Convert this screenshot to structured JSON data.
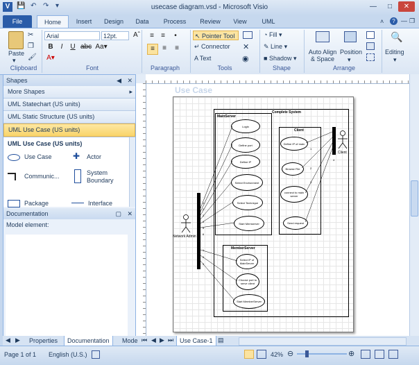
{
  "window": {
    "title": "usecase diagram.vsd - Microsoft Visio"
  },
  "tabs": [
    "File",
    "Home",
    "Insert",
    "Design",
    "Data",
    "Process",
    "Review",
    "View",
    "UML"
  ],
  "ribbon": {
    "font_name": "Arial",
    "font_size": "12pt.",
    "pointer_tool": "Pointer Tool",
    "connector": "Connector",
    "text": "Text",
    "fill": "Fill",
    "line": "Line",
    "shadow": "Shadow",
    "auto_align": "Auto Align & Space",
    "position": "Position",
    "editing": "Editing",
    "paste": "Paste",
    "groups": {
      "clipboard": "Clipboard",
      "font": "Font",
      "paragraph": "Paragraph",
      "tools": "Tools",
      "shape": "Shape",
      "arrange": "Arrange"
    }
  },
  "shapes_panel": {
    "header": "Shapes",
    "more_shapes": "More Shapes",
    "stencils": [
      "UML Statechart (US units)",
      "UML Static Structure (US units)",
      "UML Use Case (US units)"
    ],
    "section_title": "UML Use Case (US units)",
    "items": [
      {
        "label": "Use Case",
        "icon": "ellipse-icon"
      },
      {
        "label": "Actor",
        "icon": "actor-icon"
      },
      {
        "label": "Communic...",
        "icon": "connector-icon"
      },
      {
        "label": "System Boundary",
        "icon": "boundary-icon"
      },
      {
        "label": "Package",
        "icon": "package-icon"
      },
      {
        "label": "Interface",
        "icon": "interface-icon"
      }
    ]
  },
  "documentation_panel": {
    "header": "Documentation",
    "label": "Model element:"
  },
  "bottom_tabs": [
    "Properties",
    "Documentation",
    "Mode"
  ],
  "page_tab": "Use Case-1",
  "diagram": {
    "title_overlay": "Use Case",
    "system_title": "Complete System",
    "mainserver_title": "MainServer",
    "client_title": "Client",
    "memberserver_title": "MemberServer",
    "actor_admin": "Network Admin",
    "actor_client": "Client",
    "main_usecases": [
      "Login",
      "Define port",
      "Define IP",
      "Select Environment",
      "Select Technique",
      "Start Memserver"
    ],
    "client_usecases": [
      "Define IP of main",
      "Browse File",
      "connect to main server",
      "Send request"
    ],
    "member_usecases": [
      "Select IP of MainServer",
      "Choose port to serve client",
      "Start MemberServer"
    ],
    "numbers_admin": [
      "1",
      "2",
      "3",
      "4",
      "5",
      "6"
    ],
    "numbers_member": [
      "1",
      "2",
      "3"
    ],
    "numbers_client": [
      "1",
      "2",
      "3",
      "4"
    ]
  },
  "status": {
    "page": "Page 1 of 1",
    "language": "English (U.S.)",
    "zoom": "42%"
  }
}
